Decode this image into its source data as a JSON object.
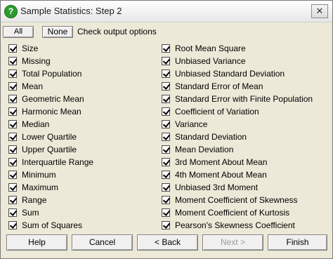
{
  "window": {
    "title": "Sample Statistics: Step 2",
    "icon": "question-mark-icon",
    "close_glyph": "✕"
  },
  "toolbar": {
    "all_label": "All",
    "none_label": "None",
    "check_label": "Check output options"
  },
  "left_options": [
    {
      "label": "Size",
      "checked": true
    },
    {
      "label": "Missing",
      "checked": true
    },
    {
      "label": "Total Population",
      "checked": true
    },
    {
      "label": "Mean",
      "checked": true
    },
    {
      "label": "Geometric Mean",
      "checked": true
    },
    {
      "label": "Harmonic Mean",
      "checked": true
    },
    {
      "label": "Median",
      "checked": true
    },
    {
      "label": "Lower Quartile",
      "checked": true
    },
    {
      "label": "Upper Quartile",
      "checked": true
    },
    {
      "label": "Interquartile Range",
      "checked": true
    },
    {
      "label": "Minimum",
      "checked": true
    },
    {
      "label": "Maximum",
      "checked": true
    },
    {
      "label": "Range",
      "checked": true
    },
    {
      "label": "Sum",
      "checked": true
    },
    {
      "label": "Sum of Squares",
      "checked": true
    }
  ],
  "right_options": [
    {
      "label": "Root Mean Square",
      "checked": true
    },
    {
      "label": "Unbiased Variance",
      "checked": true
    },
    {
      "label": "Unbiased Standard Deviation",
      "checked": true
    },
    {
      "label": "Standard Error of Mean",
      "checked": true
    },
    {
      "label": "Standard Error with Finite Population",
      "checked": true
    },
    {
      "label": "Coefficient of Variation",
      "checked": true
    },
    {
      "label": "Variance",
      "checked": true
    },
    {
      "label": "Standard Deviation",
      "checked": true
    },
    {
      "label": "Mean Deviation",
      "checked": true
    },
    {
      "label": "3rd Moment About Mean",
      "checked": true
    },
    {
      "label": "4th Moment About Mean",
      "checked": true
    },
    {
      "label": "Unbiased 3rd Moment",
      "checked": true
    },
    {
      "label": "Moment Coefficient of Skewness",
      "checked": true
    },
    {
      "label": "Moment Coefficient of Kurtosis",
      "checked": true
    },
    {
      "label": "Pearson's Skewness Coefficient",
      "checked": true
    }
  ],
  "buttons": {
    "help": "Help",
    "cancel": "Cancel",
    "back": "< Back",
    "next": "Next >",
    "finish": "Finish"
  }
}
